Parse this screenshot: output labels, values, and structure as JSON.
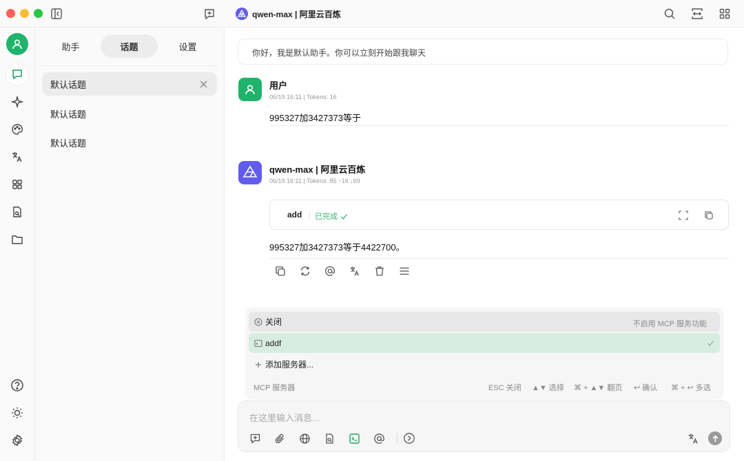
{
  "window": {
    "title": "qwen-max | 阿里云百炼"
  },
  "sidebar_tabs": [
    {
      "label": "助手"
    },
    {
      "label": "话题"
    },
    {
      "label": "设置"
    }
  ],
  "topics": [
    {
      "label": "默认话题"
    },
    {
      "label": "默认话题"
    },
    {
      "label": "默认话题"
    }
  ],
  "greeting": "你好，我是默认助手。你可以立刻开始跟我聊天",
  "messages": [
    {
      "role": "user",
      "name": "用户",
      "meta": "06/19 16:11  |  Tokens: 16",
      "text": "995327加3427373等于"
    },
    {
      "role": "assistant",
      "name": "qwen-max | 阿里云百炼",
      "meta": "06/19 16:11  |  Tokens: 85 ↑16 ↓69",
      "tool": {
        "name": "add",
        "status": "已完成"
      },
      "text": "995327加3427373等于4422700。"
    }
  ],
  "mcp_menu": {
    "items": [
      {
        "label": "关闭",
        "hint": "不启用 MCP 服务功能",
        "icon": "close-circle-icon"
      },
      {
        "label": "addf",
        "hint": "",
        "icon": "terminal-icon",
        "checked": true
      },
      {
        "label": "添加服务器...",
        "hint": "",
        "icon": "plus-icon"
      }
    ],
    "footer_title": "MCP 服务器",
    "shortcuts": {
      "close": "ESC 关闭",
      "select": "▲▼ 选择",
      "page": "⌘ + ▲▼ 翻页",
      "confirm": "↩ 确认",
      "multi": "⌘ + ↩ 多选"
    }
  },
  "input": {
    "placeholder": "在这里输入消息..."
  },
  "colors": {
    "accent": "#1fb36b",
    "model_logo": "#615ced",
    "selected_row": "#d8ede1"
  }
}
